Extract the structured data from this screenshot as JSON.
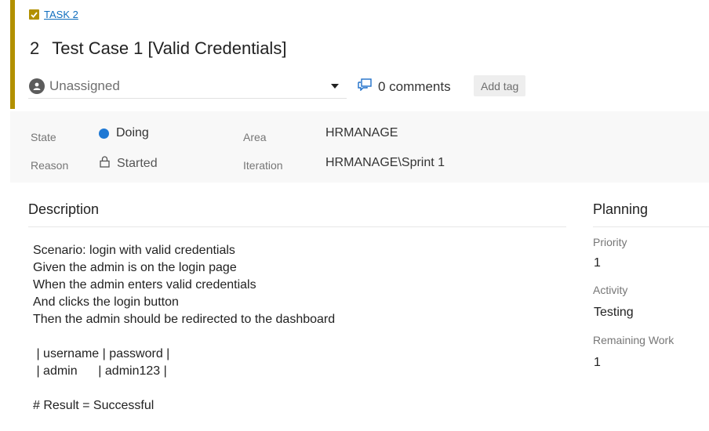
{
  "task": {
    "label": "TASK 2",
    "id": "2",
    "title": "Test Case 1 [Valid Credentials]"
  },
  "assignment": {
    "value": "Unassigned"
  },
  "comments": {
    "label": "0 comments"
  },
  "tags": {
    "add_label": "Add tag"
  },
  "fields": {
    "state_label": "State",
    "state_value": "Doing",
    "reason_label": "Reason",
    "reason_value": "Started",
    "area_label": "Area",
    "area_value": "HRMANAGE",
    "iteration_label": "Iteration",
    "iteration_value": "HRMANAGE\\Sprint 1"
  },
  "description": {
    "header": "Description",
    "lines": [
      "Scenario: login with valid credentials",
      "Given the admin is on the login page",
      "When the admin enters valid credentials",
      "And clicks the login button",
      "Then the admin should be redirected to the dashboard",
      "",
      " | username | password |",
      " | admin      | admin123 |",
      "",
      "# Result = Successful"
    ]
  },
  "planning": {
    "header": "Planning",
    "priority_label": "Priority",
    "priority_value": "1",
    "activity_label": "Activity",
    "activity_value": "Testing",
    "remaining_label": "Remaining Work",
    "remaining_value": "1"
  },
  "colors": {
    "accent": "#b29000",
    "state_doing": "#1e78d4",
    "link": "#106ebe"
  },
  "icons": [
    "task-check-icon",
    "person-icon",
    "dropdown-caret-icon",
    "comments-icon",
    "lock-icon"
  ]
}
